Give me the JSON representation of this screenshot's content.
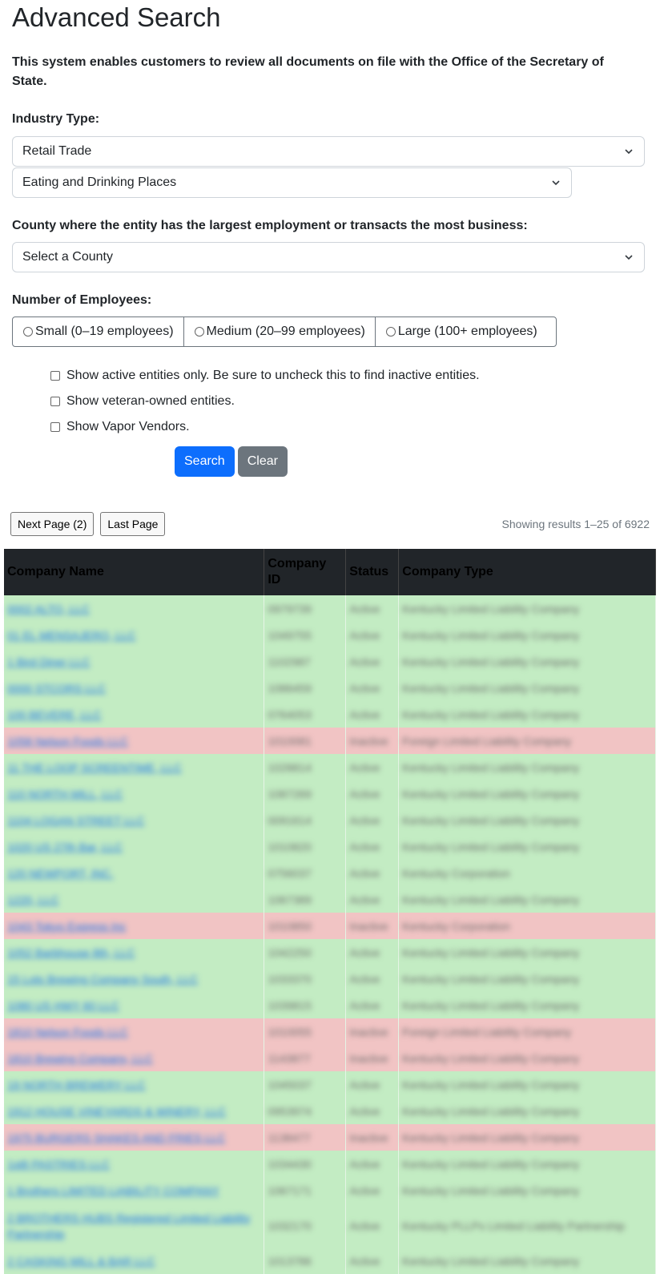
{
  "page": {
    "title": "Advanced Search",
    "intro": "This system enables customers to review all documents on file with the Office of the Secretary of State."
  },
  "industry": {
    "label": "Industry Type:",
    "primary_value": "Retail Trade",
    "secondary_value": "Eating and Drinking Places"
  },
  "county": {
    "label": "County where the entity has the largest employment or transacts the most business:",
    "value": "Select a County"
  },
  "employees": {
    "label": "Number of Employees:",
    "options": [
      "Small (0–19 employees)",
      "Medium (20–99 employees)",
      "Large (100+ employees)"
    ]
  },
  "checkboxes": [
    "Show active entities only. Be sure to uncheck this to find inactive entities.",
    "Show veteran-owned entities.",
    "Show Vapor Vendors."
  ],
  "actions": {
    "search": "Search",
    "clear": "Clear"
  },
  "pager": {
    "next": "Next Page (2)",
    "last": "Last Page",
    "showing": "Showing results 1–25 of 6922"
  },
  "table": {
    "headers": [
      "Company Name",
      "Company ID",
      "Status",
      "Company Type"
    ],
    "rows": [
      {
        "name": "0002 ALTO, LLC",
        "id": "0979739",
        "status": "Active",
        "type": "Kentucky Limited Liability Company",
        "state": "active"
      },
      {
        "name": "01 EL MENSAJERO, LLC",
        "id": "1049755",
        "status": "Active",
        "type": "Kentucky Limited Liability Company",
        "state": "active"
      },
      {
        "name": "1 Bird Diner LLC",
        "id": "1102987",
        "status": "Active",
        "type": "Kentucky Limited Liability Company",
        "state": "active"
      },
      {
        "name": "0000 STCORS LLC",
        "id": "1086459",
        "status": "Active",
        "type": "Kentucky Limited Liability Company",
        "state": "active"
      },
      {
        "name": "100 BEVERE, LLC",
        "id": "0764053",
        "status": "Active",
        "type": "Kentucky Limited Liability Company",
        "state": "active"
      },
      {
        "name": "1058 Nelson Foods LLC",
        "id": "1010081",
        "status": "Inactive",
        "type": "Foreign Limited Liability Company",
        "state": "inactive"
      },
      {
        "name": "11 THE LOOP SCREENTIME, LLC",
        "id": "1028814",
        "status": "Active",
        "type": "Kentucky Limited Liability Company",
        "state": "active"
      },
      {
        "name": "110 NORTH MILL, LLC",
        "id": "1087269",
        "status": "Active",
        "type": "Kentucky Limited Liability Company",
        "state": "active"
      },
      {
        "name": "1104 LOGAN STREET LLC",
        "id": "0091614",
        "status": "Active",
        "type": "Kentucky Limited Liability Company",
        "state": "active"
      },
      {
        "name": "1020 US 27th Bar, LLC",
        "id": "1010820",
        "status": "Active",
        "type": "Kentucky Limited Liability Company",
        "state": "active"
      },
      {
        "name": "120 NEWPORT, INC.",
        "id": "0756037",
        "status": "Active",
        "type": "Kentucky Corporation",
        "state": "active"
      },
      {
        "name": "1220, LLC",
        "id": "1067389",
        "status": "Active",
        "type": "Kentucky Limited Liability Company",
        "state": "active"
      },
      {
        "name": "1043 Tokyo Express Inc",
        "id": "1010850",
        "status": "Inactive",
        "type": "Kentucky Corporation",
        "state": "inactive"
      },
      {
        "name": "1052 Barbhouse 8th, LLC",
        "id": "1042250",
        "status": "Active",
        "type": "Kentucky Limited Liability Company",
        "state": "active"
      },
      {
        "name": "15 Lots Brewing Company South, LLC",
        "id": "1033370",
        "status": "Active",
        "type": "Kentucky Limited Liability Company",
        "state": "active"
      },
      {
        "name": "1080 US HWY 60 LLC",
        "id": "1039815",
        "status": "Active",
        "type": "Kentucky Limited Liability Company",
        "state": "active"
      },
      {
        "name": "1810 Nelson Foods LLC",
        "id": "1010055",
        "status": "Inactive",
        "type": "Foreign Limited Liability Company",
        "state": "inactive"
      },
      {
        "name": "1810 Brewing Company, LLC",
        "id": "1143877",
        "status": "Inactive",
        "type": "Kentucky Limited Liability Company",
        "state": "inactive"
      },
      {
        "name": "19 NORTH BREWERY LLC",
        "id": "1045037",
        "status": "Active",
        "type": "Kentucky Limited Liability Company",
        "state": "active"
      },
      {
        "name": "1912 HOUSE VINEYARDS & WINERY, LLC",
        "id": "0953974",
        "status": "Active",
        "type": "Kentucky Limited Liability Company",
        "state": "active"
      },
      {
        "name": "1975 BURGERS SHAKES AND FRIES LLC",
        "id": "1138477",
        "status": "Inactive",
        "type": "Kentucky Limited Liability Company",
        "state": "inactive"
      },
      {
        "name": "1st8 PASTRIES LLC",
        "id": "1034430",
        "status": "Active",
        "type": "Kentucky Limited Liability Company",
        "state": "active"
      },
      {
        "name": "1 Brothers LIMITED LIABILITY COMPANY",
        "id": "1067171",
        "status": "Active",
        "type": "Kentucky Limited Liability Company",
        "state": "active"
      },
      {
        "name": "2 BROTHERS HUBS Registered Limited Liability Partnership",
        "id": "1032170",
        "status": "Active",
        "type": "Kentucky PLLPs Limited Liability Partnership",
        "state": "active"
      },
      {
        "name": "2 CASKING MILL & BAR LLC",
        "id": "1013786",
        "status": "Active",
        "type": "Kentucky Limited Liability Company",
        "state": "active"
      }
    ]
  }
}
